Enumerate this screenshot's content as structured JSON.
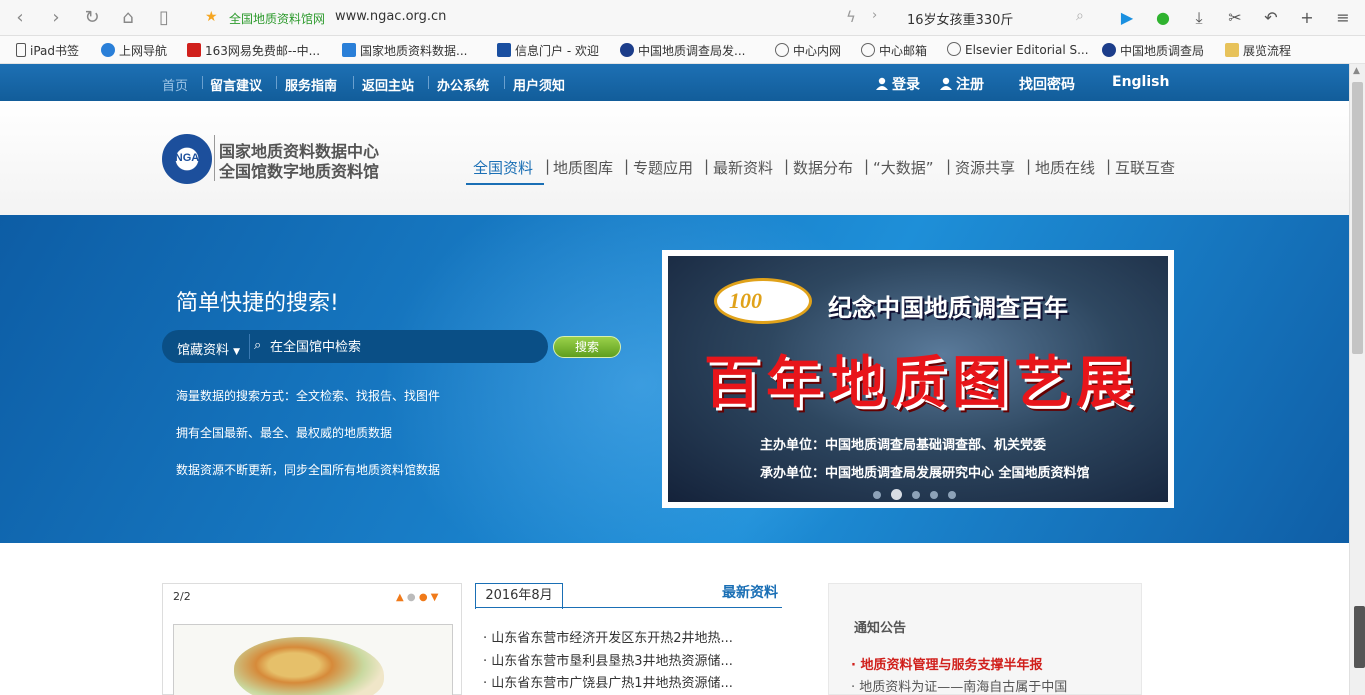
{
  "browser": {
    "page_title": "全国地质资料馆网",
    "url": "www.ngac.org.cn",
    "search_text": "16岁女孩重330斤"
  },
  "bookmarks": [
    {
      "label": "iPad书签",
      "color": "#555"
    },
    {
      "label": "上网导航",
      "color": "#2a7fd8"
    },
    {
      "label": "163网易免费邮--中...",
      "color": "#d0201c"
    },
    {
      "label": "国家地质资料数据...",
      "color": "#2a7fd8"
    },
    {
      "label": "信息门户 - 欢迎",
      "color": "#1a4fa0"
    },
    {
      "label": "中国地质调查局发...",
      "color": "#1c3d8a"
    },
    {
      "label": "中心内网",
      "color": "#666"
    },
    {
      "label": "中心邮箱",
      "color": "#666"
    },
    {
      "label": "Elsevier Editorial S...",
      "color": "#666"
    },
    {
      "label": "中国地质调查局",
      "color": "#1c3d8a"
    },
    {
      "label": "展览流程",
      "color": "#e7c25a"
    }
  ],
  "topnav": {
    "items": [
      "首页",
      "留言建议",
      "服务指南",
      "返回主站",
      "办公系统",
      "用户须知"
    ],
    "login": "登录",
    "register": "注册",
    "recover": "找回密码",
    "english": "English"
  },
  "header": {
    "logo_text": "NGA",
    "name_line1": "国家地质资料数据中心",
    "name_line2": "全国馆数字地质资料馆",
    "mainnav": [
      "全国资料",
      "地质图库",
      "专题应用",
      "最新资料",
      "数据分布",
      "“大数据”",
      "资源共享",
      "地质在线",
      "互联互查"
    ]
  },
  "hero": {
    "title": "简单快捷的搜索!",
    "select_label": "馆藏资料",
    "search_placeholder": "在全国馆中检索",
    "search_button": "搜索",
    "features": [
      "海量数据的搜索方式：全文检索、找报告、找图件",
      "拥有全国最新、最全、最权威的地质数据",
      "数据资源不断更新，同步全国所有地质资料馆数据"
    ]
  },
  "banner": {
    "logo_number": "100",
    "title": "纪念中国地质调查百年",
    "big_text": "百年地质图艺展",
    "host": "主办单位：中国地质调查局基础调查部、机关党委",
    "organizer": "承办单位：中国地质调查局发展研究中心  全国地质资料馆",
    "dot_count": 5,
    "active_dot": 1
  },
  "left_panel": {
    "page": "2/2"
  },
  "latest": {
    "date_tab": "2016年8月",
    "title": "最新资料",
    "items": [
      "山东省东营市经济开发区东开热2井地热...",
      "山东省东营市垦利县垦热3井地热资源储...",
      "山东省东营市广饶县广热1井地热资源储..."
    ]
  },
  "notice": {
    "title": "通知公告",
    "items": [
      {
        "text": "地质资料管理与服务支撑半年报",
        "color": "#d0201c",
        "bold": true
      },
      {
        "text": "地质资料为证——南海自古属于中国",
        "color": "#555",
        "bold": false
      }
    ]
  }
}
